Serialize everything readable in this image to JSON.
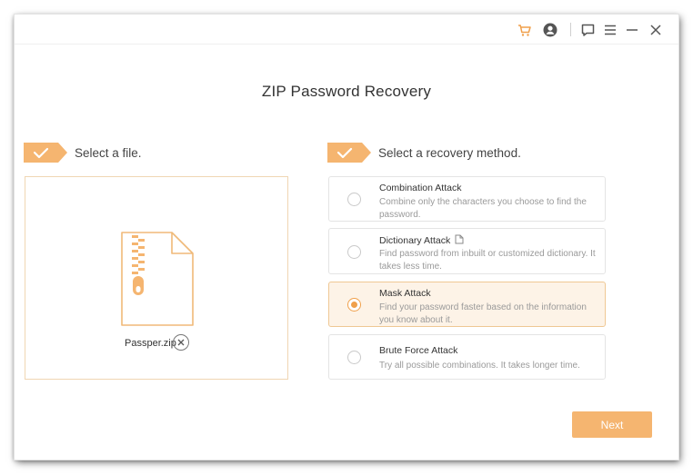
{
  "app": {
    "title": "ZIP Password Recovery"
  },
  "titlebar": {
    "icons": [
      "cart-icon",
      "account-icon",
      "feedback-icon",
      "menu-icon",
      "minimize-icon",
      "close-icon"
    ]
  },
  "colors": {
    "accent": "#f5b570",
    "accent_dark": "#f0a04b",
    "border_accent": "#f0d6b3",
    "selected_bg": "#fdf3e7"
  },
  "file_section": {
    "label": "Select a file.",
    "file_name": "Passper.zip"
  },
  "method_section": {
    "label": "Select a recovery method.",
    "methods": [
      {
        "title": "Combination Attack",
        "description": "Combine only the characters you choose to find the password.",
        "selected": false
      },
      {
        "title": "Dictionary Attack",
        "description": "Find password from inbuilt or customized dictionary. It takes less time.",
        "selected": false
      },
      {
        "title": "Mask Attack",
        "description": "Find your password faster based on the information you know about it.",
        "selected": true
      },
      {
        "title": "Brute Force Attack",
        "description": "Try all possible combinations. It takes longer time.",
        "selected": false
      }
    ]
  },
  "actions": {
    "next_label": "Next"
  }
}
